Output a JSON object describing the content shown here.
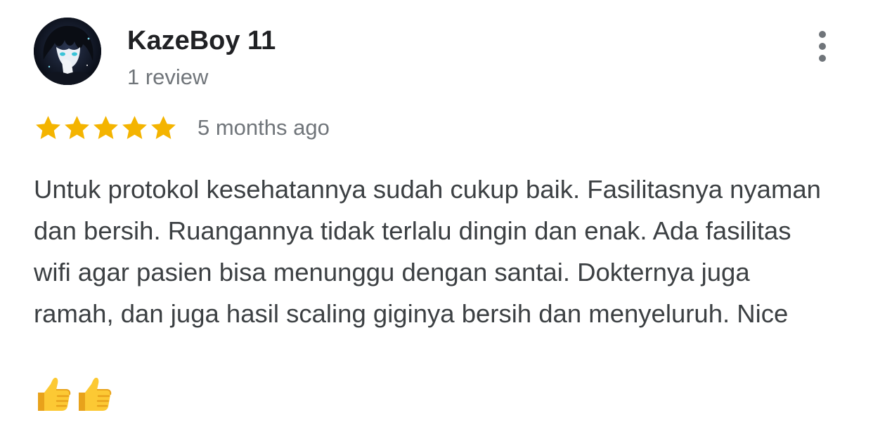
{
  "review": {
    "reviewer": {
      "name": "KazeBoy 11",
      "review_count": "1 review"
    },
    "rating": {
      "stars": 5,
      "max_stars": 5,
      "star_color": "#f4b400"
    },
    "time": "5 months ago",
    "text": "Untuk protokol kesehatannya sudah cukup baik. Fasilitasnya nyaman dan bersih. Ruangannya tidak terlalu dingin dan enak. Ada fasilitas wifi agar pasien bisa menunggu dengan santai. Dokternya juga ramah, dan juga hasil scaling giginya bersih dan menyeluruh. Nice",
    "emojis": [
      "thumbs-up",
      "thumbs-up"
    ]
  },
  "icons": {
    "more": "more-vert-icon",
    "star": "star-icon",
    "emoji": "thumbs-up-emoji"
  },
  "colors": {
    "name": "#202124",
    "secondary": "#70757a",
    "body": "#3c4043",
    "more_icon": "#70757a"
  }
}
